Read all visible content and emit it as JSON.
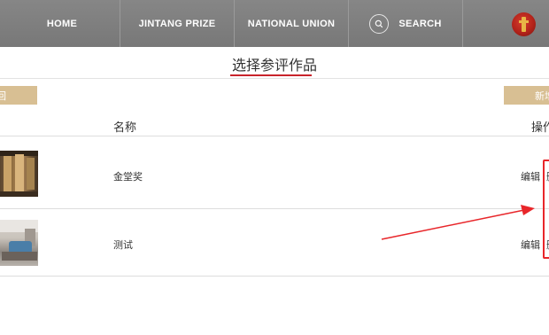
{
  "nav": {
    "home": "HOME",
    "prize": "JINTANG PRIZE",
    "union": "NATIONAL UNION",
    "search": "SEARCH"
  },
  "page": {
    "title": "选择参评作品"
  },
  "buttons": {
    "back": "回",
    "add": "新增"
  },
  "table": {
    "headers": {
      "name": "名称",
      "operation": "操作"
    },
    "rows": [
      {
        "name": "金堂奖",
        "edit": "编辑",
        "delete": "删"
      },
      {
        "name": "测试",
        "edit": "编辑",
        "delete": "删"
      }
    ]
  },
  "colors": {
    "nav_bg": "#7d7d7d",
    "accent_gold": "#d8bf93",
    "title_underline": "#c9232b",
    "annotation_red": "#e8262a"
  },
  "icons": {
    "search": "search-icon",
    "avatar": "user-avatar"
  }
}
